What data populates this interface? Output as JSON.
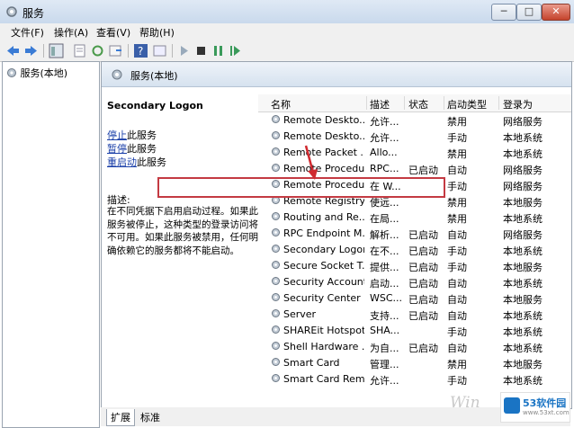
{
  "window": {
    "title": "服务",
    "min": "─",
    "max": "□",
    "close": "✕"
  },
  "menu": [
    "文件(F)",
    "操作(A)",
    "查看(V)",
    "帮助(H)"
  ],
  "tree": {
    "root": "服务(本地)"
  },
  "header": {
    "label": "服务(本地)"
  },
  "detail": {
    "title": "Secondary Logon",
    "stop_link": "停止",
    "stop_suffix": "此服务",
    "pause_link": "暂停",
    "pause_suffix": "此服务",
    "restart_link": "重启动",
    "restart_suffix": "此服务",
    "desc_label": "描述:",
    "desc_text": "在不同凭据下启用启动过程。如果此服务被停止，这种类型的登录访问将不可用。如果此服务被禁用，任何明确依赖它的服务都将不能启动。"
  },
  "columns": [
    "名称",
    "描述",
    "状态",
    "启动类型",
    "登录为"
  ],
  "rows": [
    {
      "name": "Remote Deskto...",
      "desc": "允许...",
      "status": "",
      "startup": "禁用",
      "logon": "网络服务"
    },
    {
      "name": "Remote Deskto...",
      "desc": "允许...",
      "status": "",
      "startup": "手动",
      "logon": "本地系统"
    },
    {
      "name": "Remote Packet ...",
      "desc": "Allo...",
      "status": "",
      "startup": "禁用",
      "logon": "本地系统"
    },
    {
      "name": "Remote Procedu...",
      "desc": "RPC...",
      "status": "已启动",
      "startup": "自动",
      "logon": "网络服务"
    },
    {
      "name": "Remote Procedu...",
      "desc": "在 W...",
      "status": "",
      "startup": "手动",
      "logon": "网络服务"
    },
    {
      "name": "Remote Registry",
      "desc": "使远...",
      "status": "",
      "startup": "禁用",
      "logon": "本地服务"
    },
    {
      "name": "Routing and Re...",
      "desc": "在局...",
      "status": "",
      "startup": "禁用",
      "logon": "本地系统"
    },
    {
      "name": "RPC Endpoint M...",
      "desc": "解析...",
      "status": "已启动",
      "startup": "自动",
      "logon": "网络服务"
    },
    {
      "name": "Secondary Logon",
      "desc": "在不...",
      "status": "已启动",
      "startup": "手动",
      "logon": "本地系统"
    },
    {
      "name": "Secure Socket T...",
      "desc": "提供...",
      "status": "已启动",
      "startup": "手动",
      "logon": "本地服务"
    },
    {
      "name": "Security Account...",
      "desc": "启动...",
      "status": "已启动",
      "startup": "自动",
      "logon": "本地系统"
    },
    {
      "name": "Security Center",
      "desc": "WSC...",
      "status": "已启动",
      "startup": "自动",
      "logon": "本地服务"
    },
    {
      "name": "Server",
      "desc": "支持...",
      "status": "已启动",
      "startup": "自动",
      "logon": "本地系统"
    },
    {
      "name": "SHAREit Hotspot...",
      "desc": "SHA...",
      "status": "",
      "startup": "手动",
      "logon": "本地系统"
    },
    {
      "name": "Shell Hardware ...",
      "desc": "为自...",
      "status": "已启动",
      "startup": "自动",
      "logon": "本地系统"
    },
    {
      "name": "Smart Card",
      "desc": "管理...",
      "status": "",
      "startup": "禁用",
      "logon": "本地服务"
    },
    {
      "name": "Smart Card Rem...",
      "desc": "允许...",
      "status": "",
      "startup": "手动",
      "logon": "本地系统"
    }
  ],
  "tabs": [
    "扩展",
    "标准"
  ],
  "watermark": {
    "win": "Win",
    "brand": "53软件园",
    "url": "www.53xt.com"
  },
  "colors": {
    "highlight": "#c43a42",
    "link": "#1a3fa8",
    "accent": "#1a74c4"
  }
}
